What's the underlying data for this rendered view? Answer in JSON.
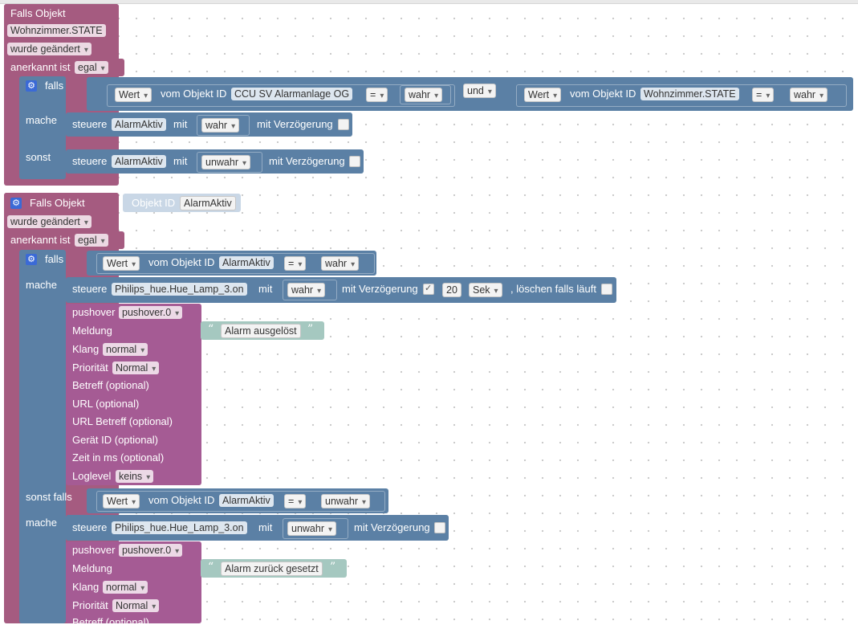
{
  "blocks": {
    "b1": {
      "title": "Falls Objekt",
      "object_id": "Wohnzimmer.STATE",
      "trigger": "wurde geändert",
      "ack_label": "anerkannt ist",
      "ack_value": "egal",
      "if_label": "falls",
      "do_label": "mache",
      "else_label": "sonst",
      "cond1": {
        "wert": "Wert",
        "vom": "vom Objekt ID",
        "obj": "CCU SV Alarmanlage OG",
        "op": "=",
        "val": "wahr"
      },
      "logic": "und",
      "cond2": {
        "wert": "Wert",
        "vom": "vom Objekt ID",
        "obj": "Wohnzimmer.STATE",
        "op": "=",
        "val": "wahr"
      },
      "do_ctrl": {
        "steuere": "steuere",
        "obj": "AlarmAktiv",
        "mit": "mit",
        "val": "wahr",
        "delay": "mit Verzögerung"
      },
      "else_ctrl": {
        "steuere": "steuere",
        "obj": "AlarmAktiv",
        "mit": "mit",
        "val": "unwahr",
        "delay": "mit Verzögerung"
      }
    },
    "b2": {
      "title": "Falls Objekt",
      "trigger_label": "Objekt ID",
      "trigger_obj": "AlarmAktiv",
      "trigger": "wurde geändert",
      "ack_label": "anerkannt ist",
      "ack_value": "egal",
      "if_label": "falls",
      "do_label": "mache",
      "elseif_label": "sonst falls",
      "do2_label": "mache",
      "cond1": {
        "wert": "Wert",
        "vom": "vom Objekt ID",
        "obj": "AlarmAktiv",
        "op": "=",
        "val": "wahr"
      },
      "ctrl1": {
        "steuere": "steuere",
        "obj": "Philips_hue.Hue_Lamp_3.on",
        "mit": "mit",
        "val": "wahr",
        "delay": "mit Verzögerung",
        "delay_val": "20",
        "unit": "Sek",
        "clear": ", löschen falls läuft"
      },
      "push1": {
        "pushover": "pushover",
        "instance": "pushover.0",
        "meldung": "Meldung",
        "message": "Alarm ausgelöst",
        "klang": "Klang",
        "klang_val": "normal",
        "prio": "Priorität",
        "prio_val": "Normal",
        "betreff": "Betreff (optional)",
        "url": "URL (optional)",
        "url_title": "URL Betreff (optional)",
        "device": "Gerät ID (optional)",
        "time": "Zeit in ms (optional)",
        "loglevel": "Loglevel",
        "loglevel_val": "keins"
      },
      "cond2": {
        "wert": "Wert",
        "vom": "vom Objekt ID",
        "obj": "AlarmAktiv",
        "op": "=",
        "val": "unwahr"
      },
      "ctrl2": {
        "steuere": "steuere",
        "obj": "Philips_hue.Hue_Lamp_3.on",
        "mit": "mit",
        "val": "unwahr",
        "delay": "mit Verzögerung"
      },
      "push2": {
        "pushover": "pushover",
        "instance": "pushover.0",
        "meldung": "Meldung",
        "message": "Alarm zurück gesetzt",
        "klang": "Klang",
        "klang_val": "normal",
        "prio": "Priorität",
        "prio_val": "Normal",
        "betreff": "Betreff (optional)"
      }
    }
  },
  "icons": {
    "gear": "gear-icon",
    "quote_open": "“",
    "quote_close": "”"
  },
  "colors": {
    "event": "#a55b80",
    "logic": "#5b80a5",
    "pushover": "#a55b94",
    "text": "#a5c8c0"
  }
}
